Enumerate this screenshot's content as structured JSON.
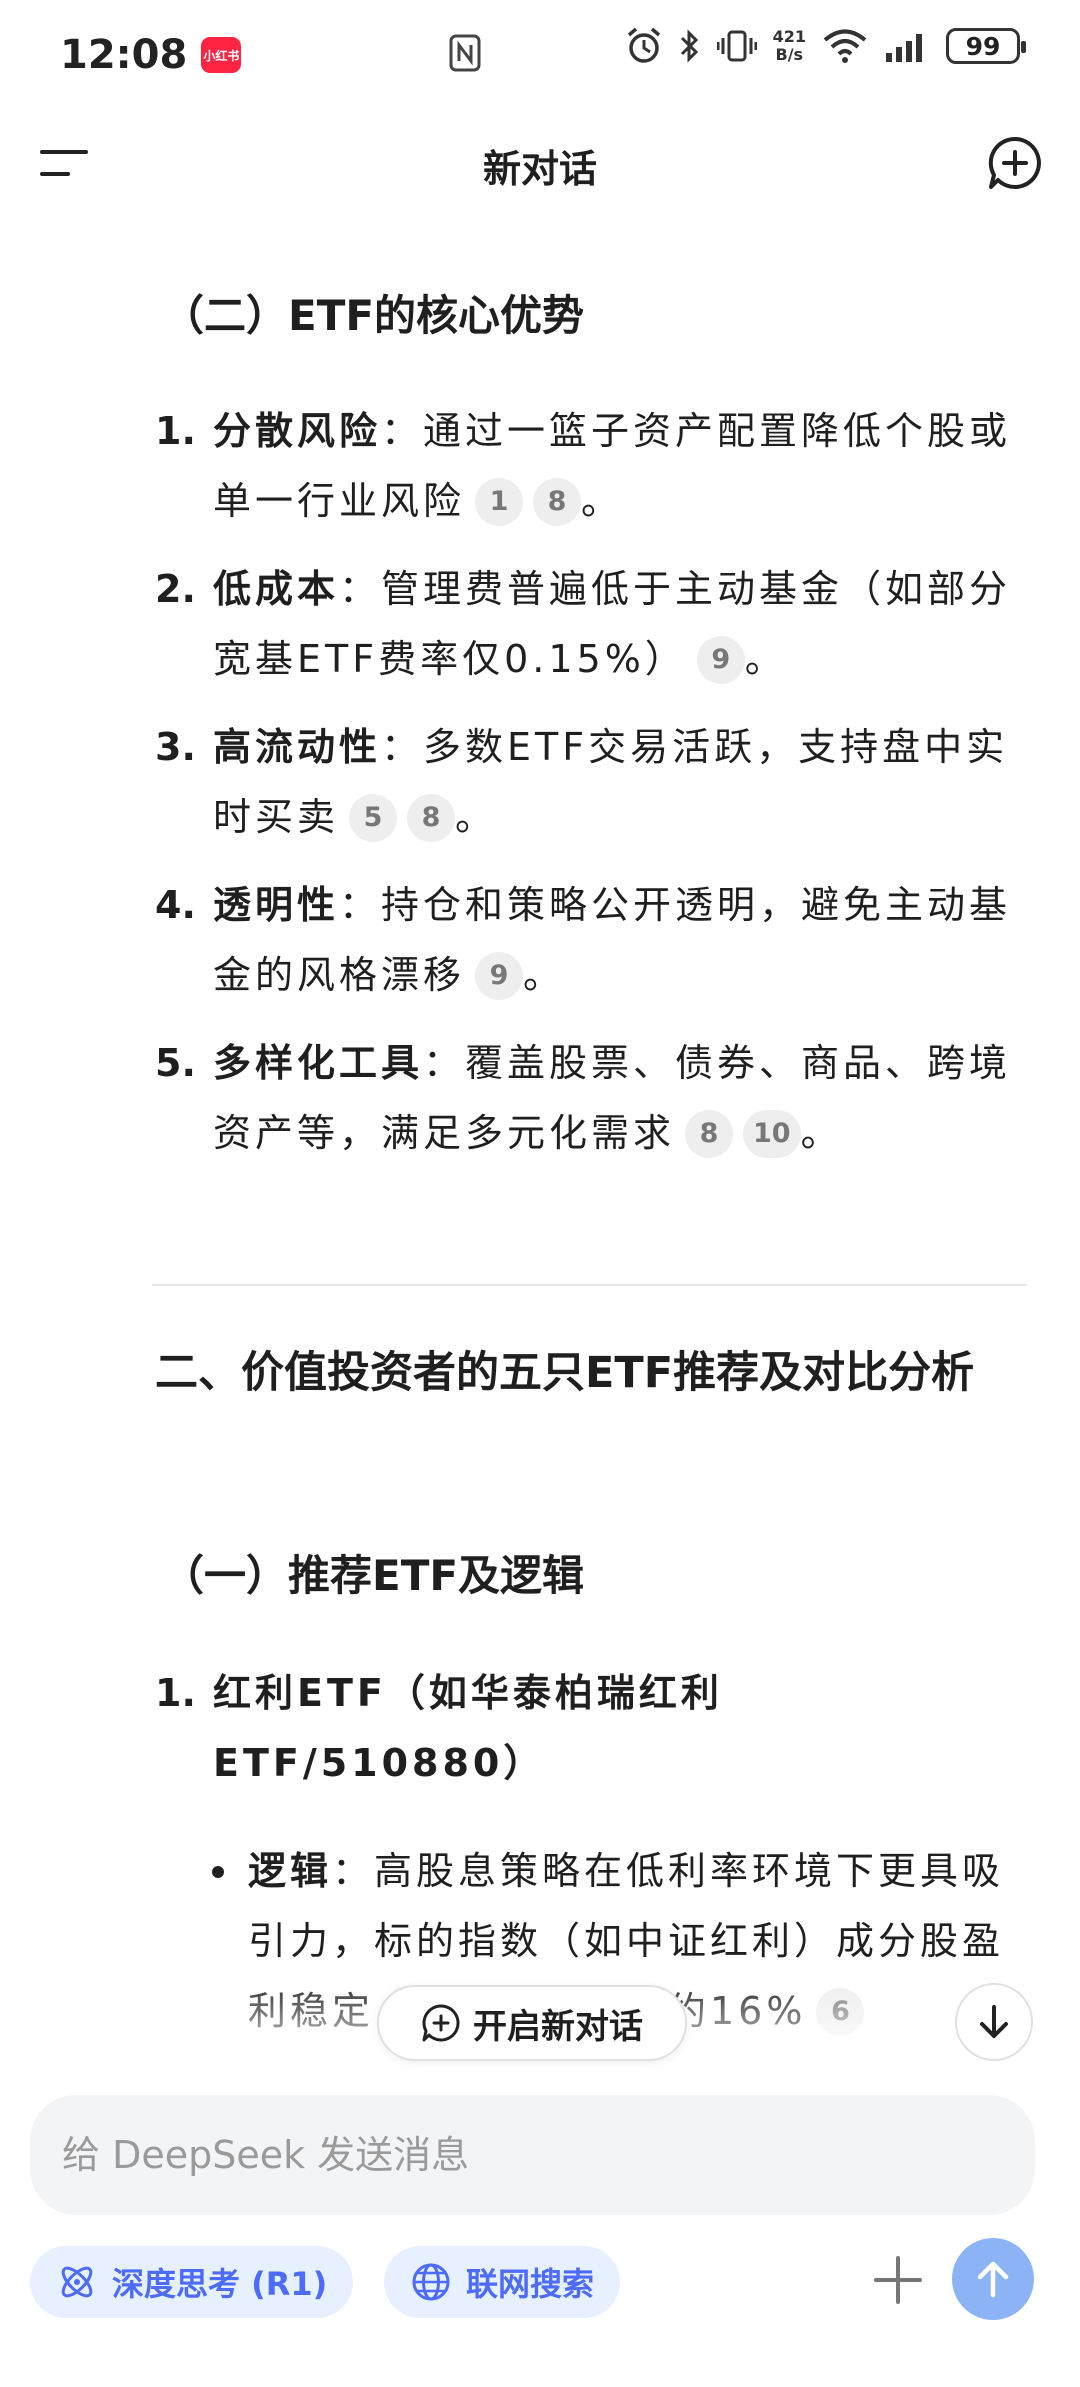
{
  "status_bar": {
    "time": "12:08",
    "app_badge": "小红书",
    "net_speed_value": "421",
    "net_speed_unit": "B/s",
    "battery": "99"
  },
  "header": {
    "title": "新对话"
  },
  "content": {
    "section1_subtitle": "（二）ETF的核心优势",
    "advantages": [
      {
        "num": "1.",
        "term": "分散风险",
        "text": "：通过一篮子资产配置降低个股或单一行业风险",
        "cites": [
          "1",
          "8"
        ],
        "end": "。"
      },
      {
        "num": "2.",
        "term": "低成本",
        "text": "：管理费普遍低于主动基金（如部分宽基ETF费率仅0.15%）",
        "cites": [
          "9"
        ],
        "end": "。"
      },
      {
        "num": "3.",
        "term": "高流动性",
        "text": "：多数ETF交易活跃，支持盘中实时买卖",
        "cites": [
          "5",
          "8"
        ],
        "end": "。"
      },
      {
        "num": "4.",
        "term": "透明性",
        "text": "：持仓和策略公开透明，避免主动基金的风格漂移",
        "cites": [
          "9"
        ],
        "end": "。"
      },
      {
        "num": "5.",
        "term": "多样化工具",
        "text": "：覆盖股票、债券、商品、跨境资产等，满足多元化需求",
        "cites": [
          "8",
          "10"
        ],
        "end": "。"
      }
    ],
    "section2_title": "二、价值投资者的五只ETF推荐及对比分析",
    "section2_subtitle": "（一）推荐ETF及逻辑",
    "recommend": {
      "num": "1.",
      "title": "红利ETF（如华泰柏瑞红利ETF/510880）",
      "bullet_term": "逻辑",
      "bullet_text": "：高股息策略在低利率环境下更具吸引力，标的指数（如中证红利）成分股盈利稳定，长期年化收益约16%",
      "bullet_cite": "6"
    }
  },
  "floating": {
    "new_chat_label": "开启新对话"
  },
  "composer": {
    "placeholder": "给 DeepSeek 发送消息",
    "deep_think_label": "深度思考 (R1)",
    "web_search_label": "联网搜索"
  },
  "colors": {
    "accent": "#4d6bfe",
    "pill_bg": "#e6f0fe",
    "send_button": "#8db3f7",
    "citation_bg": "#eeeeee"
  }
}
